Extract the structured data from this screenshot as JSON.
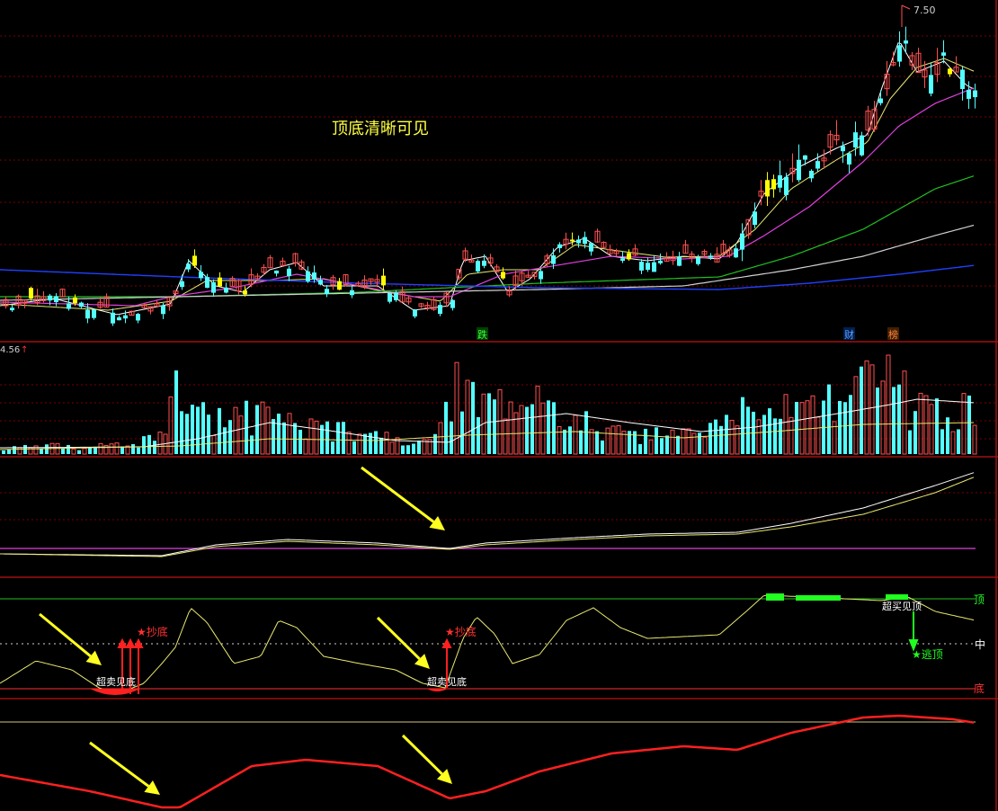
{
  "colors": {
    "background": "#000000",
    "panel_border": "#a01010",
    "grid": "#7a0000",
    "candle_up": "#ff5050",
    "candle_down": "#54ffff",
    "candle_limit": "#ffff00",
    "ma_white": "#ffffff",
    "ma_yellow": "#e8e870",
    "ma_magenta": "#e040e0",
    "ma_green": "#20c020",
    "ma_grey": "#d0d0d0",
    "ma_blue": "#2040ff",
    "arrow_yellow": "#ffff20",
    "signal_red": "#ff2020",
    "signal_green": "#20ff20"
  },
  "price_panel": {
    "high_label": "7.50",
    "caption": "顶底清晰可见",
    "markers": [
      {
        "text": "跌",
        "color": "#40ff40"
      },
      {
        "text": "财",
        "color": "#60a0ff"
      },
      {
        "text": "榜",
        "color": "#ff8040"
      }
    ]
  },
  "volume_panel": {
    "max_label": "4.56",
    "max_arrow": "↑"
  },
  "oscillator_panel": {
    "level_top": "顶",
    "level_mid": "中",
    "level_bottom": "底",
    "oversold_label_1": "超卖见底",
    "oversold_label_2": "超卖见底",
    "overbought_label": "超买见顶",
    "buy_label_1": "★抄底",
    "buy_label_2": "★抄底",
    "sell_label": "★逃顶"
  }
}
